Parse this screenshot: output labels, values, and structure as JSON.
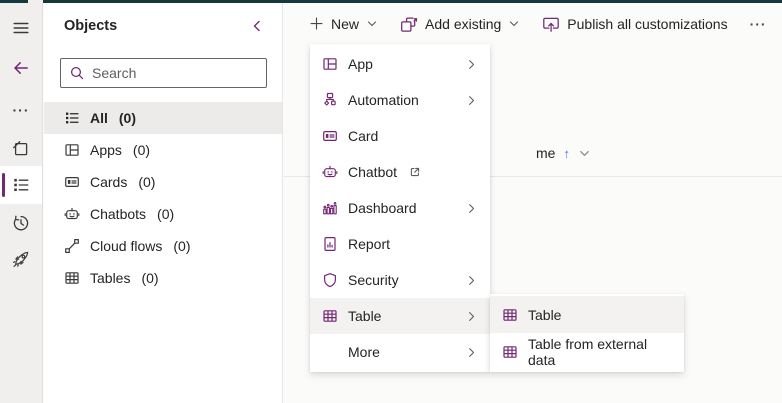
{
  "colors": {
    "accent_purple": "#742774",
    "top_strip": "#14383d",
    "selected_item_bg": "#edebe9",
    "hover_item_bg": "#f3f2f1",
    "text": "#242424",
    "muted_text": "#605e5c",
    "sort_arrow_blue": "#4f6bed",
    "rail_bg": "#f0efee",
    "divider": "#e1dfdd"
  },
  "rail": {
    "icons": [
      "hamburger-menu",
      "back-arrow",
      "more-dots",
      "pages",
      "objects-list (selected)",
      "history",
      "rocket"
    ],
    "more_glyph": "···"
  },
  "panel": {
    "title": "Objects",
    "search_placeholder": "Search",
    "items": [
      {
        "label": "All",
        "count": "(0)",
        "icon": "detailed-list",
        "selected": true
      },
      {
        "label": "Apps",
        "count": "(0)",
        "icon": "app-grid"
      },
      {
        "label": "Cards",
        "count": "(0)",
        "icon": "card"
      },
      {
        "label": "Chatbots",
        "count": "(0)",
        "icon": "chatbot"
      },
      {
        "label": "Cloud flows",
        "count": "(0)",
        "icon": "flow"
      },
      {
        "label": "Tables",
        "count": "(0)",
        "icon": "table"
      }
    ]
  },
  "command_bar": {
    "new": "New",
    "add_existing": "Add existing",
    "publish": "Publish all customizations",
    "overflow_glyph": "···"
  },
  "grid": {
    "header_fragment": "me",
    "sort_glyph": "↑",
    "note": "column header partially hidden behind open menu"
  },
  "new_menu": {
    "items": [
      {
        "label": "App",
        "icon": "app-grid",
        "has_submenu": true
      },
      {
        "label": "Automation",
        "icon": "automation",
        "has_submenu": true
      },
      {
        "label": "Card",
        "icon": "card",
        "has_submenu": false
      },
      {
        "label": "Chatbot",
        "icon": "chatbot",
        "has_submenu": false,
        "external_link": true
      },
      {
        "label": "Dashboard",
        "icon": "dashboard",
        "has_submenu": true
      },
      {
        "label": "Report",
        "icon": "report",
        "has_submenu": false
      },
      {
        "label": "Security",
        "icon": "shield",
        "has_submenu": true
      },
      {
        "label": "Table",
        "icon": "table",
        "has_submenu": true,
        "highlighted": true
      },
      {
        "label": "More",
        "icon": null,
        "has_submenu": true
      }
    ]
  },
  "table_submenu": {
    "items": [
      {
        "label": "Table",
        "icon": "table",
        "highlighted": true
      },
      {
        "label": "Table from external data",
        "icon": "table"
      }
    ]
  }
}
